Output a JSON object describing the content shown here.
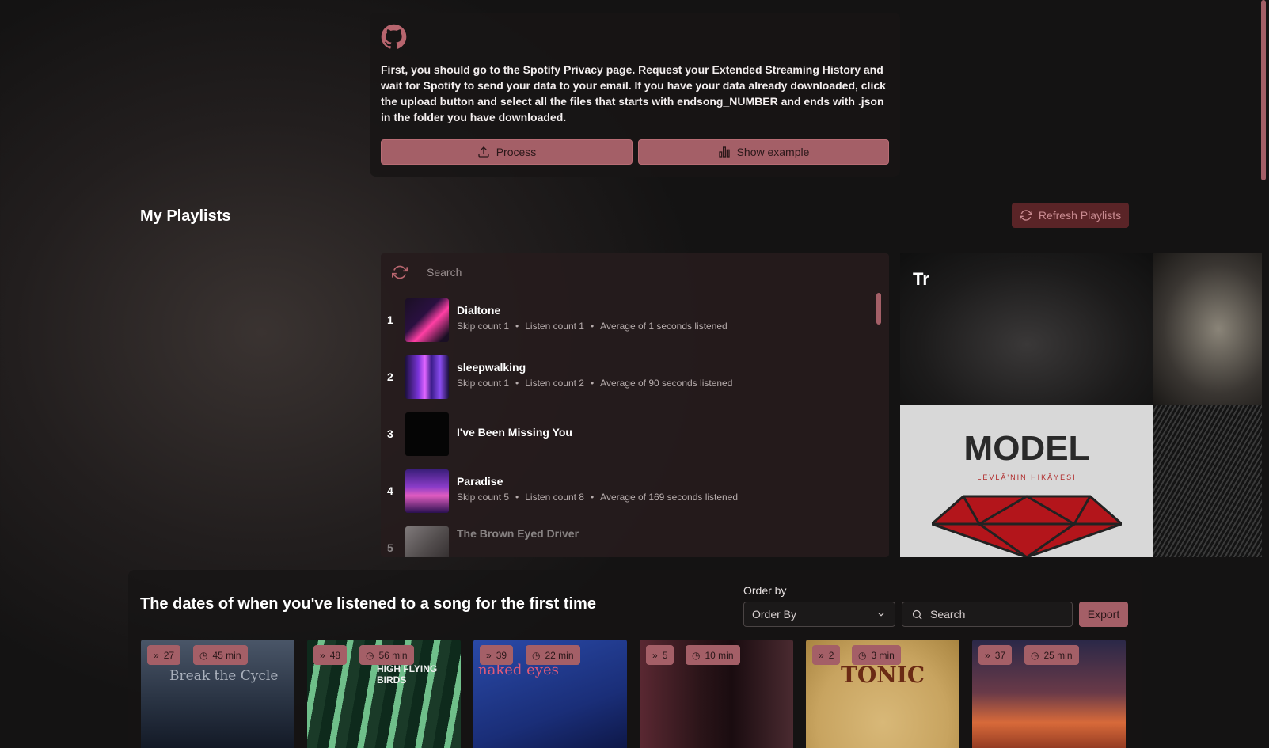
{
  "intro": {
    "text": "First, you should go to the Spotify Privacy page. Request your Extended Streaming History and wait for Spotify to send your data to your email. If you have your data already downloaded, click the upload button and select all the files that starts with endsong_NUMBER and ends with .json in the folder you have downloaded.",
    "process_label": "Process",
    "example_label": "Show example"
  },
  "playlists": {
    "title": "My Playlists",
    "refresh_label": "Refresh Playlists",
    "search_placeholder": "Search",
    "collage_label": "Tr",
    "tracks": [
      {
        "num": "1",
        "name": "Dialtone",
        "skip": "Skip count 1",
        "listen": "Listen count 1",
        "avg": "Average of 1 seconds listened"
      },
      {
        "num": "2",
        "name": "sleepwalking",
        "skip": "Skip count 1",
        "listen": "Listen count 2",
        "avg": "Average of 90 seconds listened"
      },
      {
        "num": "3",
        "name": "I've Been Missing You",
        "skip": "",
        "listen": "",
        "avg": ""
      },
      {
        "num": "4",
        "name": "Paradise",
        "skip": "Skip count 5",
        "listen": "Listen count 8",
        "avg": "Average of 169 seconds listened"
      },
      {
        "num": "5",
        "name": "The Brown Eyed Driver",
        "skip": "",
        "listen": "",
        "avg": ""
      }
    ]
  },
  "first_listen": {
    "title": "The dates of when you've listened to a song for the first time",
    "order_label": "Order by",
    "order_value": "Order By",
    "search_placeholder": "Search",
    "export_label": "Export",
    "albums": [
      {
        "plays": "27",
        "minutes": "45 min",
        "art_text": "Break the Cycle"
      },
      {
        "plays": "48",
        "minutes": "56 min",
        "art_text": "HIGH FLYING BIRDS"
      },
      {
        "plays": "39",
        "minutes": "22 min",
        "art_text": "naked eyes"
      },
      {
        "plays": "5",
        "minutes": "10 min",
        "art_text": ""
      },
      {
        "plays": "2",
        "minutes": "3 min",
        "art_text": "TONIC"
      },
      {
        "plays": "37",
        "minutes": "25 min",
        "art_text": ""
      }
    ]
  },
  "collage_art": {
    "model_text": "MODEL",
    "model_sub": "LEVLÂ'NIN HIKÂYESI"
  },
  "colors": {
    "accent": "#a45f67",
    "background": "#141313"
  }
}
